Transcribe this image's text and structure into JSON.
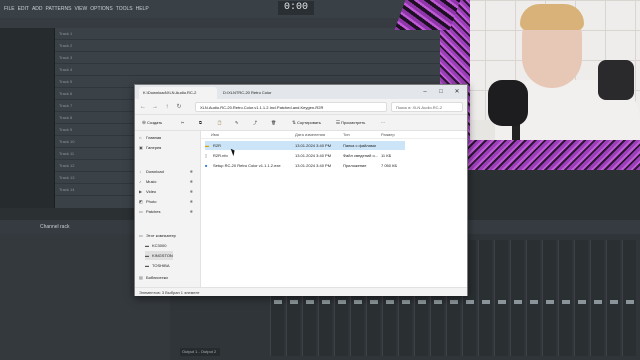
{
  "fl": {
    "menu": [
      "FILE",
      "EDIT",
      "ADD",
      "PATTERNS",
      "VIEW",
      "OPTIONS",
      "TOOLS",
      "HELP"
    ],
    "time": "0:00",
    "channel_rack_label": "Channel rack",
    "output_label": "Output 1 - Output 2",
    "tracks": [
      "Track 1",
      "Track 2",
      "Track 3",
      "Track 4",
      "Track 5",
      "Track 6",
      "Track 7",
      "Track 8",
      "Track 9",
      "Track 10",
      "Track 11",
      "Track 12",
      "Track 13",
      "Track 14"
    ]
  },
  "explorer": {
    "tab1": "K:\\Download\\XLN.Audio.RC-2",
    "tab2": "D:\\XLNTRC-20 Retro Color",
    "path": "XLN.Audio.RC-20.Retro.Color.v1.1.1.2.Incl.Patched.and.Keygen-R2R",
    "search_placeholder": "Поиск в: XLN.Audio.RC-2",
    "toolbar": {
      "create": "Создать",
      "sort": "Сортировать",
      "view": "Просмотреть"
    },
    "sidebar": {
      "home": "Главная",
      "gallery": "Галерея",
      "download": "Download",
      "music": "Music",
      "video": "Video",
      "photo": "Photo",
      "patches": "Patches",
      "this_pc": "Этот компьютер",
      "drive1": "KC3000",
      "drive2": "KINGSTON",
      "drive3": "TOSHIBA",
      "libraries": "Библиотеки"
    },
    "columns": {
      "name": "Имя",
      "date": "Дата изменения",
      "type": "Тип",
      "size": "Размер"
    },
    "files": [
      {
        "name": "R2R",
        "date": "13.01.2024 3:40 PM",
        "type": "Папка с файлами",
        "size": ""
      },
      {
        "name": "R2R.nfo",
        "date": "13.01.2024 3:40 PM",
        "type": "Файл сведений о...",
        "size": "11 КБ"
      },
      {
        "name": "Setup RC-20 Retro Color v1.1.1.2.exe",
        "date": "13.01.2024 3:40 PM",
        "type": "Приложение",
        "size": "7 050 КБ"
      }
    ],
    "status": "Элементов: 3   Выбран 1 элемент"
  }
}
